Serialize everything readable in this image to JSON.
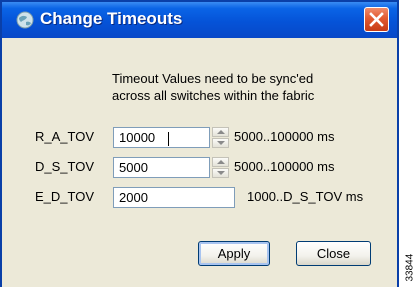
{
  "window": {
    "title": "Change Timeouts",
    "accent": "#0553d8"
  },
  "description": {
    "line1": "Timeout Values need to be sync'ed",
    "line2": "across all switches within the fabric"
  },
  "rows": [
    {
      "label": "R_A_TOV",
      "value": "10000",
      "range": "5000..100000 ms",
      "spinner": true,
      "focused": true
    },
    {
      "label": "D_S_TOV",
      "value": "5000",
      "range": "5000..100000 ms",
      "spinner": true
    },
    {
      "label": "E_D_TOV",
      "value": "2000",
      "range": "1000..D_S_TOV ms",
      "spinner": false
    }
  ],
  "buttons": {
    "apply": "Apply",
    "close": "Close"
  },
  "icons": {
    "app": "app-globe-icon",
    "close": "close-x-icon",
    "spin_up": "spin-up-arrow-icon",
    "spin_down": "spin-down-arrow-icon"
  },
  "figure_number": "33844"
}
